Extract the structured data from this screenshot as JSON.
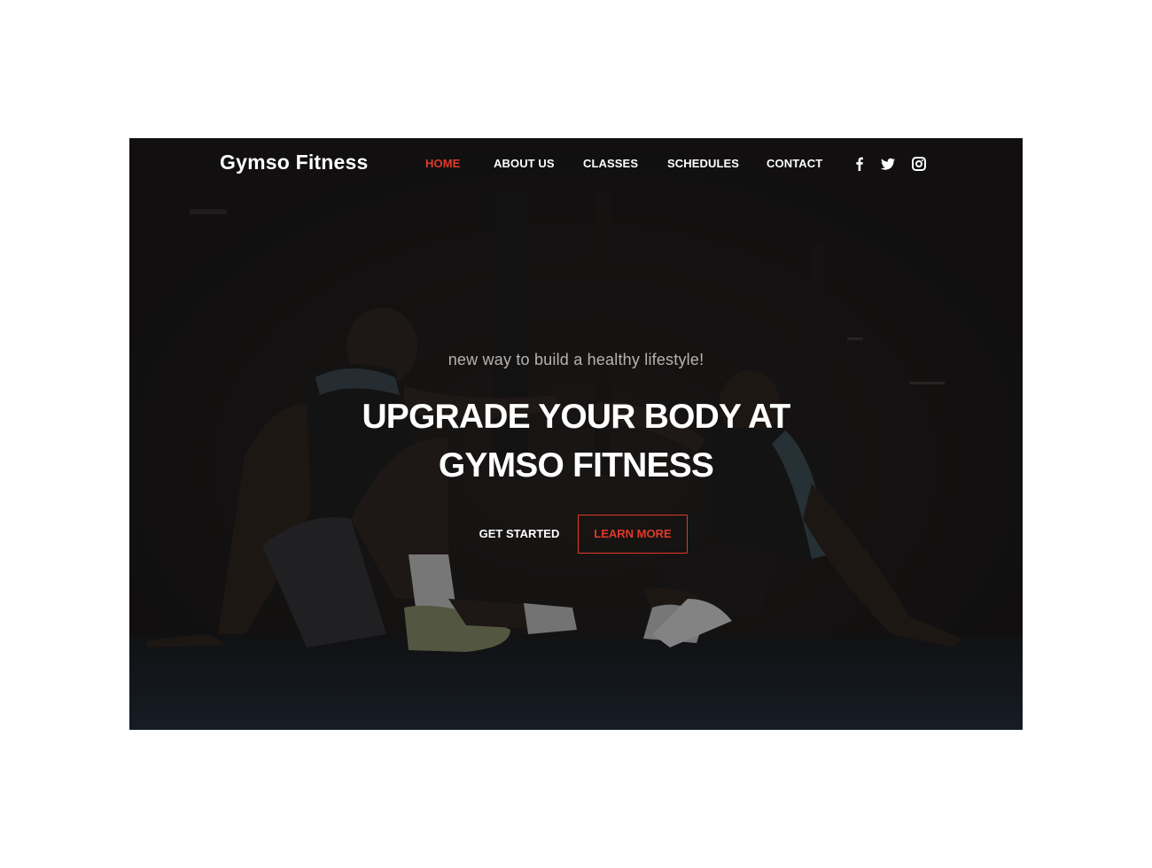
{
  "brand": {
    "name": "Gymso Fitness"
  },
  "nav": {
    "items": [
      {
        "label": "HOME",
        "active": true
      },
      {
        "label": "ABOUT US",
        "active": false
      },
      {
        "label": "CLASSES",
        "active": false
      },
      {
        "label": "SCHEDULES",
        "active": false
      },
      {
        "label": "CONTACT",
        "active": false
      }
    ],
    "social_icons": [
      "facebook-icon",
      "twitter-icon",
      "instagram-icon"
    ]
  },
  "hero": {
    "tagline": "new way to build a healthy lifestyle!",
    "headline_line1": "UPGRADE YOUR BODY AT",
    "headline_line2": "GYMSO FITNESS",
    "primary_cta": "GET STARTED",
    "secondary_cta": "LEARN MORE"
  },
  "colors": {
    "accent": "#e1392a",
    "hero_background": "#141313",
    "text_primary": "#ffffff",
    "text_muted": "#b8b3ae"
  }
}
